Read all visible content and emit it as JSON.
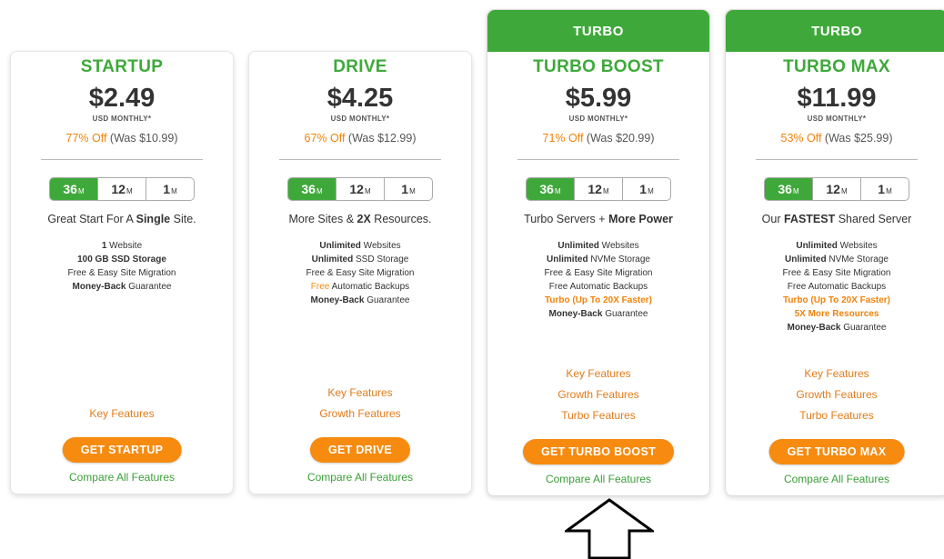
{
  "colors": {
    "brand_green": "#3ea93a",
    "accent_orange": "#f68b10",
    "link_orange": "#e07b1a",
    "compare_green": "#3a9f37"
  },
  "plans": [
    {
      "banner": "",
      "name": "STARTUP",
      "price": "$2.49",
      "period": "USD MONTHLY*",
      "discount_off": "77% Off",
      "discount_was": "(Was $10.99)",
      "terms": [
        {
          "value": "36",
          "unit": "M"
        },
        {
          "value": "12",
          "unit": "M"
        },
        {
          "value": "1",
          "unit": "M"
        }
      ],
      "active_term": "36",
      "tagline_parts": [
        "Great Start For A ",
        "Single",
        " Site."
      ],
      "features": [
        [
          {
            "t": "1",
            "b": true
          },
          {
            "t": " Website",
            "b": false
          }
        ],
        [
          {
            "t": "100 GB SSD Storage",
            "b": true
          }
        ],
        [
          {
            "t": "Free & Easy Site Migration",
            "b": false
          }
        ],
        [
          {
            "t": "Money-Back",
            "b": true
          },
          {
            "t": " Guarantee",
            "b": false
          }
        ]
      ],
      "links": [
        "Key Features"
      ],
      "cta": "GET STARTUP",
      "compare": "Compare All Features"
    },
    {
      "banner": "",
      "name": "DRIVE",
      "price": "$4.25",
      "period": "USD MONTHLY*",
      "discount_off": "67% Off",
      "discount_was": "(Was $12.99)",
      "terms": [
        {
          "value": "36",
          "unit": "M"
        },
        {
          "value": "12",
          "unit": "M"
        },
        {
          "value": "1",
          "unit": "M"
        }
      ],
      "active_term": "36",
      "tagline_parts": [
        "More Sites & ",
        "2X",
        " Resources."
      ],
      "features": [
        [
          {
            "t": "Unlimited",
            "b": true
          },
          {
            "t": " Websites",
            "b": false
          }
        ],
        [
          {
            "t": "Unlimited",
            "b": true
          },
          {
            "t": " SSD Storage",
            "b": false
          }
        ],
        [
          {
            "t": "Free & Easy Site Migration",
            "b": false
          }
        ],
        [
          {
            "t": "Free",
            "b": false,
            "o": true
          },
          {
            "t": " Automatic Backups",
            "b": false
          }
        ],
        [
          {
            "t": "Money-Back",
            "b": true
          },
          {
            "t": " Guarantee",
            "b": false
          }
        ]
      ],
      "links": [
        "Key Features",
        "Growth Features"
      ],
      "cta": "GET DRIVE",
      "compare": "Compare All Features"
    },
    {
      "banner": "TURBO",
      "name": "TURBO BOOST",
      "price": "$5.99",
      "period": "USD MONTHLY*",
      "discount_off": "71% Off",
      "discount_was": "(Was $20.99)",
      "terms": [
        {
          "value": "36",
          "unit": "M"
        },
        {
          "value": "12",
          "unit": "M"
        },
        {
          "value": "1",
          "unit": "M"
        }
      ],
      "active_term": "36",
      "tagline_parts": [
        "Turbo Servers + ",
        "More Power",
        ""
      ],
      "features": [
        [
          {
            "t": "Unlimited",
            "b": true
          },
          {
            "t": " Websites",
            "b": false
          }
        ],
        [
          {
            "t": "Unlimited",
            "b": true
          },
          {
            "t": " NVMe Storage",
            "b": false
          }
        ],
        [
          {
            "t": "Free & Easy Site Migration",
            "b": false
          }
        ],
        [
          {
            "t": "Free Automatic Backups",
            "b": false
          }
        ],
        [
          {
            "t": "Turbo (Up To 20X Faster)",
            "b": true,
            "o": true
          }
        ],
        [
          {
            "t": "Money-Back",
            "b": true
          },
          {
            "t": " Guarantee",
            "b": false
          }
        ]
      ],
      "links": [
        "Key Features",
        "Growth Features",
        "Turbo Features"
      ],
      "cta": "GET TURBO BOOST",
      "compare": "Compare All Features"
    },
    {
      "banner": "TURBO",
      "name": "TURBO MAX",
      "price": "$11.99",
      "period": "USD MONTHLY*",
      "discount_off": "53% Off",
      "discount_was": "(Was $25.99)",
      "terms": [
        {
          "value": "36",
          "unit": "M"
        },
        {
          "value": "12",
          "unit": "M"
        },
        {
          "value": "1",
          "unit": "M"
        }
      ],
      "active_term": "36",
      "tagline_parts": [
        "Our ",
        "FASTEST",
        " Shared Server"
      ],
      "features": [
        [
          {
            "t": "Unlimited",
            "b": true
          },
          {
            "t": " Websites",
            "b": false
          }
        ],
        [
          {
            "t": "Unlimited",
            "b": true
          },
          {
            "t": " NVMe Storage",
            "b": false
          }
        ],
        [
          {
            "t": "Free & Easy Site Migration",
            "b": false
          }
        ],
        [
          {
            "t": "Free Automatic Backups",
            "b": false
          }
        ],
        [
          {
            "t": "Turbo (Up To 20X Faster)",
            "b": true,
            "o": true
          }
        ],
        [
          {
            "t": "5X More Resources",
            "b": true,
            "o": true
          }
        ],
        [
          {
            "t": "Money-Back",
            "b": true
          },
          {
            "t": " Guarantee",
            "b": false
          }
        ]
      ],
      "links": [
        "Key Features",
        "Growth Features",
        "Turbo Features"
      ],
      "cta": "GET TURBO MAX",
      "compare": "Compare All Features"
    }
  ],
  "annotation": {
    "icon": "up-arrow-icon"
  }
}
